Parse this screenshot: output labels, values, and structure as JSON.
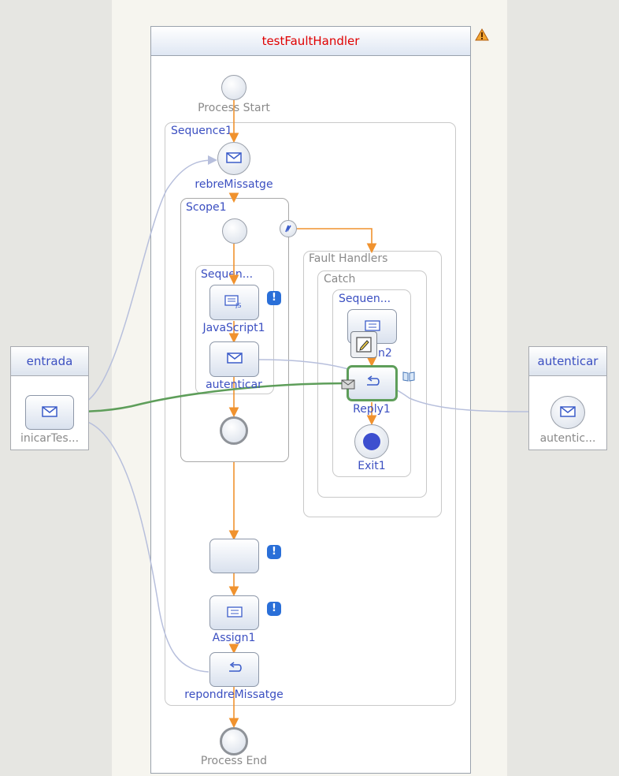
{
  "process": {
    "title": "testFaultHandler"
  },
  "partner_links": {
    "left": {
      "title": "entrada",
      "operation": "inicarTes..."
    },
    "right": {
      "title": "autenticar",
      "operation": "autentic..."
    }
  },
  "nodes": {
    "process_start": "Process Start",
    "process_end": "Process End",
    "sequence1": "Sequence1",
    "receive": "rebreMissatge",
    "scope1": "Scope1",
    "inner_sequence": "Sequen...",
    "javascript": "JavaScript1",
    "invoke": "autenticar",
    "fault_handlers": "Fault Handlers",
    "catch": "Catch",
    "catch_sequence": "Sequen...",
    "catch_activity_partial": "n2",
    "reply": "Reply1",
    "exit": "Exit1",
    "assign": "Assign1",
    "respond": "repondreMissatge"
  },
  "icons": {
    "warning": "warning-triangle-icon",
    "fault": "fault-handler-icon",
    "message": "envelope-icon",
    "script": "javascript-icon",
    "assign": "assign-icon",
    "reply": "reply-arrow-icon",
    "exit": "exit-icon",
    "edit": "edit-pencil-icon",
    "book": "documentation-book-icon",
    "info": "info-badge-icon"
  },
  "colors": {
    "title": "#e00000",
    "label": "#3b4fc1",
    "flow": "#f0922e",
    "selected": "#5e9e5a",
    "partner_link": "#b7bfdc"
  }
}
